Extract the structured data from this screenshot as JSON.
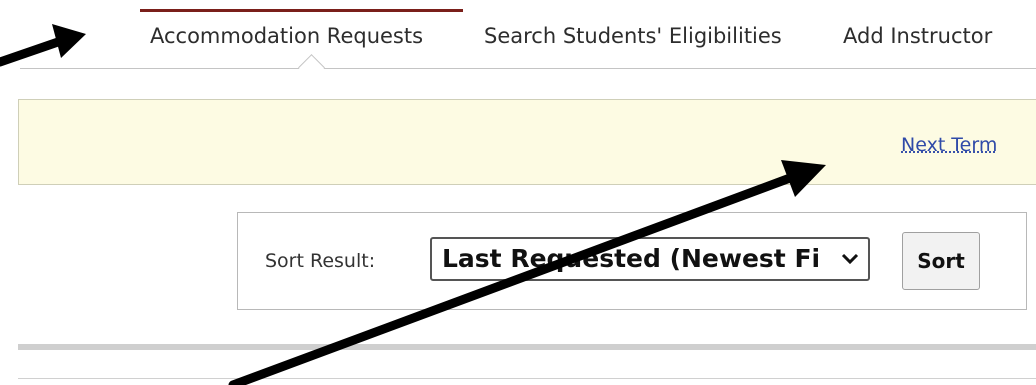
{
  "nav": {
    "tabs": [
      {
        "label": "Accommodation Requests",
        "active": true
      },
      {
        "label": "Search Students' Eligibilities",
        "active": false
      },
      {
        "label": "Add Instructor",
        "active": false
      }
    ],
    "active_tab_color": "#7a1f1a"
  },
  "term_banner": {
    "next_term_link": "Next Term",
    "background_color": "#fdfbe3"
  },
  "sort": {
    "label": "Sort Result:",
    "selected_option": "Last Requested (Newest First)",
    "button_label": "Sort"
  },
  "annotations": [
    {
      "type": "arrow",
      "color": "#000000",
      "points_to": "Accommodation Requests tab"
    },
    {
      "type": "arrow",
      "color": "#000000",
      "points_to": "Next Term link"
    }
  ]
}
